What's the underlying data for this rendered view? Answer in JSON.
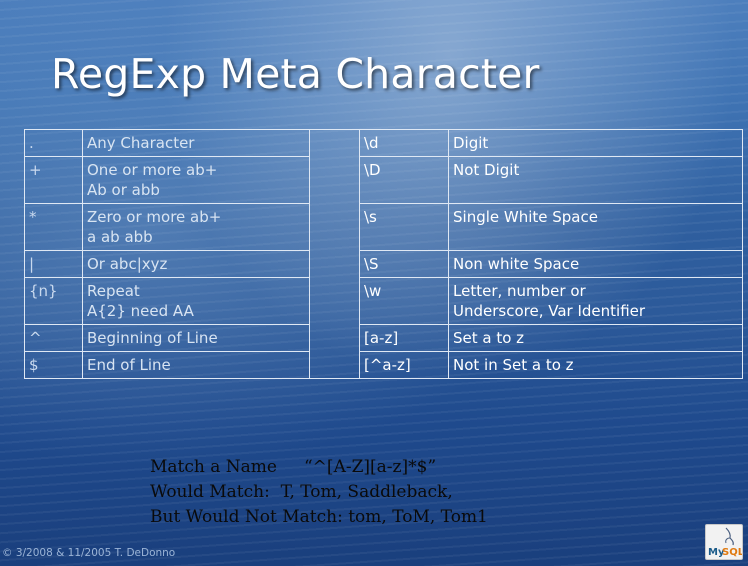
{
  "title": "RegExp Meta Character",
  "table": {
    "rows": [
      {
        "sym_l": ".",
        "desc_l": [
          "Any Character"
        ],
        "sym_r": "\\d",
        "desc_r": [
          "Digit"
        ]
      },
      {
        "sym_l": "+",
        "desc_l": [
          "One or more ab+",
          "Ab or abb"
        ],
        "sym_r": "\\D",
        "desc_r": [
          "Not Digit"
        ]
      },
      {
        "sym_l": "*",
        "desc_l": [
          "Zero or more ab+",
          "a ab abb"
        ],
        "sym_r": "\\s",
        "desc_r": [
          "Single White Space"
        ]
      },
      {
        "sym_l": "|",
        "desc_l": [
          "Or abc|xyz"
        ],
        "sym_r": "\\S",
        "desc_r": [
          "Non white Space"
        ]
      },
      {
        "sym_l": "{n}",
        "desc_l": [
          "Repeat",
          "A{2} need AA"
        ],
        "sym_r": "\\w",
        "desc_r": [
          "Letter, number  or",
          "Underscore, Var Identifier"
        ]
      },
      {
        "sym_l": "^",
        "desc_l": [
          "Beginning of Line"
        ],
        "sym_r": "[a-z]",
        "desc_r": [
          "Set a to z"
        ]
      },
      {
        "sym_l": "$",
        "desc_l": [
          "End of Line"
        ],
        "sym_r": "[^a-z]",
        "desc_r": [
          "Not in Set a to z"
        ]
      }
    ]
  },
  "example": {
    "line1": "Match a Name     “^[A-Z][a-z]*$”",
    "line2": "Would Match:  T, Tom, Saddleback,",
    "line3": "But Would Not Match: tom, ToM, Tom1"
  },
  "footer": "© 3/2008 & 11/2005 T. DeDonno",
  "logo": {
    "text_my": "My",
    "text_sql": "SQL",
    "icon": "mysql-dolphin-logo"
  }
}
